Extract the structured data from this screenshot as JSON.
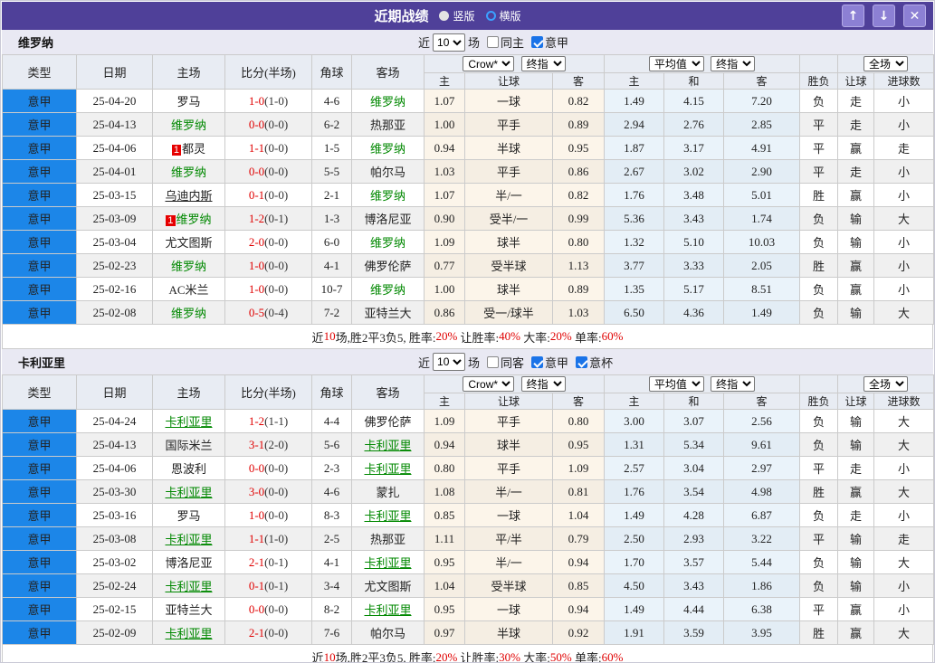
{
  "titlebar": {
    "title": "近期战绩",
    "layout_options": [
      {
        "label": "竖版",
        "selected": true
      },
      {
        "label": "横版",
        "selected": false
      }
    ]
  },
  "colors": {
    "titlebar_purple": "#4F4099",
    "league_blue": "#1C86E8",
    "team_green": "#008800",
    "win_red": "#E00000",
    "draw_green": "#009900",
    "lose_blue": "#2222DD"
  },
  "table_columns": {
    "type": "类型",
    "date": "日期",
    "home": "主场",
    "score": "比分(半场)",
    "corner": "角球",
    "away": "客场",
    "odds_group": {
      "select1": "Crow*",
      "select2": "终指",
      "cols": [
        "主",
        "让球",
        "客"
      ]
    },
    "avg_group": {
      "select1": "平均值",
      "select2": "终指",
      "cols": [
        "主",
        "和",
        "客"
      ]
    },
    "full_group": {
      "select": "全场",
      "cols": [
        "胜负",
        "让球",
        "进球数"
      ]
    }
  },
  "result_color_map": {
    "胜": "r",
    "赢": "r",
    "大": "r",
    "平": "g",
    "走": "g",
    "负": "b",
    "输": "b",
    "小": "b"
  },
  "sections": [
    {
      "team": "维罗纳",
      "controls": {
        "near": "近",
        "count": "10",
        "games": "场",
        "same": {
          "label": "同主",
          "checked": false
        },
        "leagues": [
          {
            "label": "意甲",
            "checked": true
          }
        ]
      },
      "rows": [
        {
          "league": "意甲",
          "date": "25-04-20",
          "home": {
            "name": "罗马"
          },
          "ft": "1-0",
          "ht": "(1-0)",
          "corner": "4-6",
          "away": {
            "name": "维罗纳",
            "focus": true
          },
          "odds": [
            "1.07",
            "一球",
            "0.82"
          ],
          "avg": [
            "1.49",
            "4.15",
            "7.20"
          ],
          "res": [
            "负",
            "走",
            "小"
          ]
        },
        {
          "league": "意甲",
          "date": "25-04-13",
          "home": {
            "name": "维罗纳",
            "focus": true
          },
          "ft": "0-0",
          "ht": "(0-0)",
          "corner": "6-2",
          "away": {
            "name": "热那亚"
          },
          "odds": [
            "1.00",
            "平手",
            "0.89"
          ],
          "avg": [
            "2.94",
            "2.76",
            "2.85"
          ],
          "res": [
            "平",
            "走",
            "小"
          ]
        },
        {
          "league": "意甲",
          "date": "25-04-06",
          "home": {
            "name": "都灵",
            "badge": "1"
          },
          "ft": "1-1",
          "ht": "(0-0)",
          "corner": "1-5",
          "away": {
            "name": "维罗纳",
            "focus": true
          },
          "odds": [
            "0.94",
            "半球",
            "0.95"
          ],
          "avg": [
            "1.87",
            "3.17",
            "4.91"
          ],
          "res": [
            "平",
            "赢",
            "走"
          ]
        },
        {
          "league": "意甲",
          "date": "25-04-01",
          "home": {
            "name": "维罗纳",
            "focus": true
          },
          "ft": "0-0",
          "ht": "(0-0)",
          "corner": "5-5",
          "away": {
            "name": "帕尔马"
          },
          "odds": [
            "1.03",
            "平手",
            "0.86"
          ],
          "avg": [
            "2.67",
            "3.02",
            "2.90"
          ],
          "res": [
            "平",
            "走",
            "小"
          ]
        },
        {
          "league": "意甲",
          "date": "25-03-15",
          "home": {
            "name": "乌迪内斯",
            "ul": true
          },
          "ft": "0-1",
          "ht": "(0-0)",
          "corner": "2-1",
          "away": {
            "name": "维罗纳",
            "focus": true
          },
          "odds": [
            "1.07",
            "半/一",
            "0.82"
          ],
          "avg": [
            "1.76",
            "3.48",
            "5.01"
          ],
          "res": [
            "胜",
            "赢",
            "小"
          ]
        },
        {
          "league": "意甲",
          "date": "25-03-09",
          "home": {
            "name": "维罗纳",
            "focus": true,
            "badge": "1"
          },
          "ft": "1-2",
          "ht": "(0-1)",
          "corner": "1-3",
          "away": {
            "name": "博洛尼亚"
          },
          "odds": [
            "0.90",
            "受半/一",
            "0.99"
          ],
          "avg": [
            "5.36",
            "3.43",
            "1.74"
          ],
          "res": [
            "负",
            "输",
            "大"
          ]
        },
        {
          "league": "意甲",
          "date": "25-03-04",
          "home": {
            "name": "尤文图斯"
          },
          "ft": "2-0",
          "ht": "(0-0)",
          "corner": "6-0",
          "away": {
            "name": "维罗纳",
            "focus": true
          },
          "odds": [
            "1.09",
            "球半",
            "0.80"
          ],
          "avg": [
            "1.32",
            "5.10",
            "10.03"
          ],
          "res": [
            "负",
            "输",
            "小"
          ]
        },
        {
          "league": "意甲",
          "date": "25-02-23",
          "home": {
            "name": "维罗纳",
            "focus": true
          },
          "ft": "1-0",
          "ht": "(0-0)",
          "corner": "4-1",
          "away": {
            "name": "佛罗伦萨"
          },
          "odds": [
            "0.77",
            "受半球",
            "1.13"
          ],
          "avg": [
            "3.77",
            "3.33",
            "2.05"
          ],
          "res": [
            "胜",
            "赢",
            "小"
          ]
        },
        {
          "league": "意甲",
          "date": "25-02-16",
          "home": {
            "name": "AC米兰"
          },
          "ft": "1-0",
          "ht": "(0-0)",
          "corner": "10-7",
          "away": {
            "name": "维罗纳",
            "focus": true
          },
          "odds": [
            "1.00",
            "球半",
            "0.89"
          ],
          "avg": [
            "1.35",
            "5.17",
            "8.51"
          ],
          "res": [
            "负",
            "赢",
            "小"
          ]
        },
        {
          "league": "意甲",
          "date": "25-02-08",
          "home": {
            "name": "维罗纳",
            "focus": true
          },
          "ft": "0-5",
          "ht": "(0-4)",
          "corner": "7-2",
          "away": {
            "name": "亚特兰大"
          },
          "odds": [
            "0.86",
            "受一/球半",
            "1.03"
          ],
          "avg": [
            "6.50",
            "4.36",
            "1.49"
          ],
          "res": [
            "负",
            "输",
            "大"
          ]
        }
      ],
      "summary": [
        {
          "t": "近"
        },
        {
          "t": "10",
          "red": true
        },
        {
          "t": "场,胜2平3负5, 胜率:"
        },
        {
          "t": "20%",
          "red": true
        },
        {
          "t": " 让胜率:"
        },
        {
          "t": "40%",
          "red": true
        },
        {
          "t": " 大率:"
        },
        {
          "t": "20%",
          "red": true
        },
        {
          "t": " 单率:"
        },
        {
          "t": "60%",
          "red": true
        }
      ]
    },
    {
      "team": "卡利亚里",
      "controls": {
        "near": "近",
        "count": "10",
        "games": "场",
        "same": {
          "label": "同客",
          "checked": false
        },
        "leagues": [
          {
            "label": "意甲",
            "checked": true
          },
          {
            "label": "意杯",
            "checked": true
          }
        ]
      },
      "rows": [
        {
          "league": "意甲",
          "date": "25-04-24",
          "home": {
            "name": "卡利亚里",
            "focus": true,
            "ul": true
          },
          "ft": "1-2",
          "ht": "(1-1)",
          "corner": "4-4",
          "away": {
            "name": "佛罗伦萨"
          },
          "odds": [
            "1.09",
            "平手",
            "0.80"
          ],
          "avg": [
            "3.00",
            "3.07",
            "2.56"
          ],
          "res": [
            "负",
            "输",
            "大"
          ]
        },
        {
          "league": "意甲",
          "date": "25-04-13",
          "home": {
            "name": "国际米兰"
          },
          "ft": "3-1",
          "ht": "(2-0)",
          "corner": "5-6",
          "away": {
            "name": "卡利亚里",
            "focus": true,
            "ul": true
          },
          "odds": [
            "0.94",
            "球半",
            "0.95"
          ],
          "avg": [
            "1.31",
            "5.34",
            "9.61"
          ],
          "res": [
            "负",
            "输",
            "大"
          ]
        },
        {
          "league": "意甲",
          "date": "25-04-06",
          "home": {
            "name": "恩波利"
          },
          "ft": "0-0",
          "ht": "(0-0)",
          "corner": "2-3",
          "away": {
            "name": "卡利亚里",
            "focus": true,
            "ul": true
          },
          "odds": [
            "0.80",
            "平手",
            "1.09"
          ],
          "avg": [
            "2.57",
            "3.04",
            "2.97"
          ],
          "res": [
            "平",
            "走",
            "小"
          ]
        },
        {
          "league": "意甲",
          "date": "25-03-30",
          "home": {
            "name": "卡利亚里",
            "focus": true,
            "ul": true
          },
          "ft": "3-0",
          "ht": "(0-0)",
          "corner": "4-6",
          "away": {
            "name": "蒙扎"
          },
          "odds": [
            "1.08",
            "半/一",
            "0.81"
          ],
          "avg": [
            "1.76",
            "3.54",
            "4.98"
          ],
          "res": [
            "胜",
            "赢",
            "大"
          ]
        },
        {
          "league": "意甲",
          "date": "25-03-16",
          "home": {
            "name": "罗马"
          },
          "ft": "1-0",
          "ht": "(0-0)",
          "corner": "8-3",
          "away": {
            "name": "卡利亚里",
            "focus": true,
            "ul": true
          },
          "odds": [
            "0.85",
            "一球",
            "1.04"
          ],
          "avg": [
            "1.49",
            "4.28",
            "6.87"
          ],
          "res": [
            "负",
            "走",
            "小"
          ]
        },
        {
          "league": "意甲",
          "date": "25-03-08",
          "home": {
            "name": "卡利亚里",
            "focus": true,
            "ul": true
          },
          "ft": "1-1",
          "ht": "(1-0)",
          "corner": "2-5",
          "away": {
            "name": "热那亚"
          },
          "odds": [
            "1.11",
            "平/半",
            "0.79"
          ],
          "avg": [
            "2.50",
            "2.93",
            "3.22"
          ],
          "res": [
            "平",
            "输",
            "走"
          ]
        },
        {
          "league": "意甲",
          "date": "25-03-02",
          "home": {
            "name": "博洛尼亚"
          },
          "ft": "2-1",
          "ht": "(0-1)",
          "corner": "4-1",
          "away": {
            "name": "卡利亚里",
            "focus": true,
            "ul": true
          },
          "odds": [
            "0.95",
            "半/一",
            "0.94"
          ],
          "avg": [
            "1.70",
            "3.57",
            "5.44"
          ],
          "res": [
            "负",
            "输",
            "大"
          ]
        },
        {
          "league": "意甲",
          "date": "25-02-24",
          "home": {
            "name": "卡利亚里",
            "focus": true,
            "ul": true
          },
          "ft": "0-1",
          "ht": "(0-1)",
          "corner": "3-4",
          "away": {
            "name": "尤文图斯"
          },
          "odds": [
            "1.04",
            "受半球",
            "0.85"
          ],
          "avg": [
            "4.50",
            "3.43",
            "1.86"
          ],
          "res": [
            "负",
            "输",
            "小"
          ]
        },
        {
          "league": "意甲",
          "date": "25-02-15",
          "home": {
            "name": "亚特兰大"
          },
          "ft": "0-0",
          "ht": "(0-0)",
          "corner": "8-2",
          "away": {
            "name": "卡利亚里",
            "focus": true,
            "ul": true
          },
          "odds": [
            "0.95",
            "一球",
            "0.94"
          ],
          "avg": [
            "1.49",
            "4.44",
            "6.38"
          ],
          "res": [
            "平",
            "赢",
            "小"
          ]
        },
        {
          "league": "意甲",
          "date": "25-02-09",
          "home": {
            "name": "卡利亚里",
            "focus": true,
            "ul": true
          },
          "ft": "2-1",
          "ht": "(0-0)",
          "corner": "7-6",
          "away": {
            "name": "帕尔马"
          },
          "odds": [
            "0.97",
            "半球",
            "0.92"
          ],
          "avg": [
            "1.91",
            "3.59",
            "3.95"
          ],
          "res": [
            "胜",
            "赢",
            "大"
          ]
        }
      ],
      "summary": [
        {
          "t": "近"
        },
        {
          "t": "10",
          "red": true
        },
        {
          "t": "场,胜2平3负5, 胜率:"
        },
        {
          "t": "20%",
          "red": true
        },
        {
          "t": " 让胜率:"
        },
        {
          "t": "30%",
          "red": true
        },
        {
          "t": " 大率:"
        },
        {
          "t": "50%",
          "red": true
        },
        {
          "t": " 单率:"
        },
        {
          "t": "60%",
          "red": true
        }
      ]
    }
  ]
}
